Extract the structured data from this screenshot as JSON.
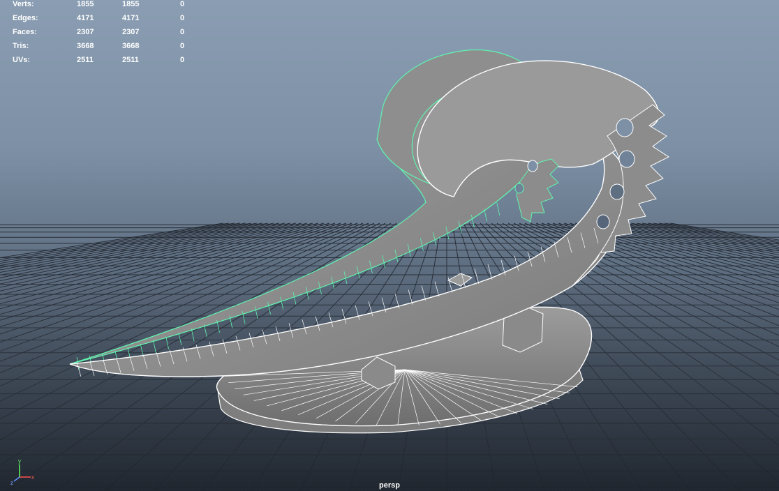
{
  "hud": {
    "rows": [
      {
        "label": "Verts:",
        "c1": "1855",
        "c2": "1855",
        "c3": "0"
      },
      {
        "label": "Edges:",
        "c1": "4171",
        "c2": "4171",
        "c3": "0"
      },
      {
        "label": "Faces:",
        "c1": "2307",
        "c2": "2307",
        "c3": "0"
      },
      {
        "label": "Tris:",
        "c1": "3668",
        "c2": "3668",
        "c3": "0"
      },
      {
        "label": "UVs:",
        "c1": "2511",
        "c2": "2511",
        "c3": "0"
      }
    ]
  },
  "viewport": {
    "camera_name": "persp"
  },
  "gizmo": {
    "x_label": "x",
    "y_label": "y",
    "z_label": "z"
  },
  "colors": {
    "background_top": "#8a9db2",
    "background_bottom": "#252c35",
    "grid": "#1e232b",
    "mesh_face": "#8f8f8f",
    "mesh_wire": "#ffffff",
    "selected_wire": "#5ff5b0",
    "hud_text": "#ffffff"
  }
}
